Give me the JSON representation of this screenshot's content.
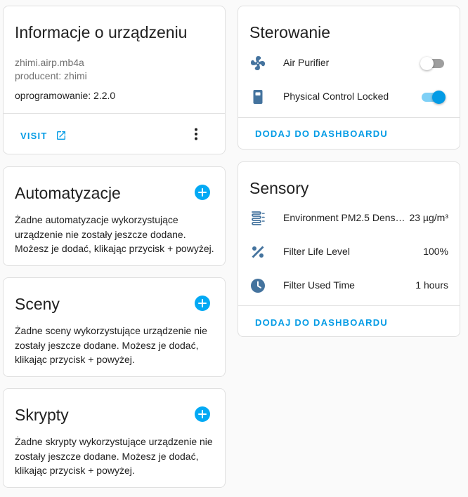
{
  "device_info": {
    "title": "Informacje o urządzeniu",
    "model": "zhimi.airp.mb4a",
    "manufacturer": "producent: zhimi",
    "firmware": "oprogramowanie: 2.2.0",
    "visit_label": "VISIT"
  },
  "automations": {
    "title": "Automatyzacje",
    "empty_text": "Żadne automatyzacje wykorzystujące urządzenie nie zostały jeszcze dodane. Możesz je dodać, klikając przycisk + powyżej."
  },
  "scenes": {
    "title": "Sceny",
    "empty_text": "Żadne sceny wykorzystujące urządzenie nie zostały jeszcze dodane. Możesz je dodać, klikając przycisk + powyżej."
  },
  "scripts": {
    "title": "Skrypty",
    "empty_text": "Żadne skrypty wykorzystujące urządzenie nie zostały jeszcze dodane. Możesz je dodać, klikając przycisk + powyżej."
  },
  "controls": {
    "title": "Sterowanie",
    "items": [
      {
        "icon": "fan-icon",
        "label": "Air Purifier",
        "state": "off"
      },
      {
        "icon": "lock-device-icon",
        "label": "Physical Control Locked",
        "state": "on"
      }
    ],
    "add_label": "DODAJ DO DASHBOARDU"
  },
  "sensors": {
    "title": "Sensory",
    "items": [
      {
        "icon": "air-filter-icon",
        "label": "Environment PM2.5 Dens…",
        "value": "23 µg/m³"
      },
      {
        "icon": "percent-icon",
        "label": "Filter Life Level",
        "value": "100%"
      },
      {
        "icon": "clock-icon",
        "label": "Filter Used Time",
        "value": "1 hours"
      }
    ],
    "add_label": "DODAJ DO DASHBOARDU"
  },
  "colors": {
    "accent": "#03a9f4",
    "link": "#039be5",
    "icon": "#44739e"
  }
}
